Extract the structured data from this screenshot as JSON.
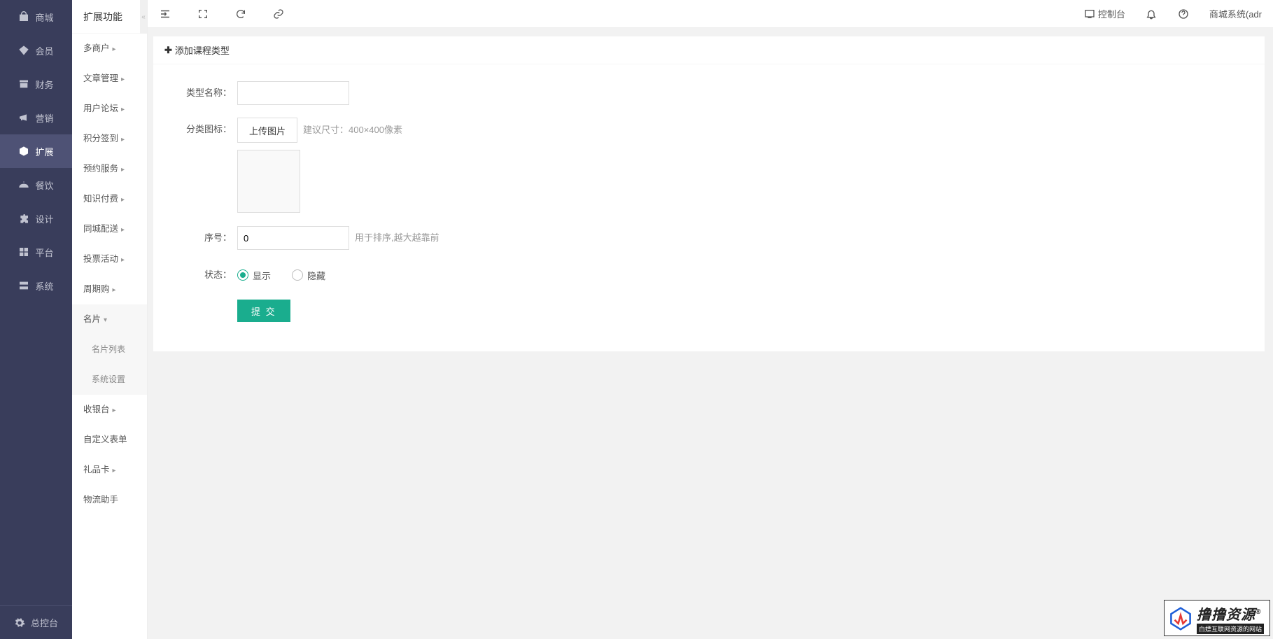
{
  "sidebar_primary": {
    "items": [
      {
        "label": "商城",
        "icon": "bag-icon"
      },
      {
        "label": "会员",
        "icon": "diamond-icon"
      },
      {
        "label": "财务",
        "icon": "archive-icon"
      },
      {
        "label": "营销",
        "icon": "megaphone-icon"
      },
      {
        "label": "扩展",
        "icon": "cube-icon",
        "active": true
      },
      {
        "label": "餐饮",
        "icon": "dish-icon"
      },
      {
        "label": "设计",
        "icon": "puzzle-icon"
      },
      {
        "label": "平台",
        "icon": "grid-icon"
      },
      {
        "label": "系统",
        "icon": "server-icon"
      }
    ],
    "bottom": {
      "label": "总控台",
      "icon": "gear-icon"
    }
  },
  "sidebar_secondary": {
    "title": "扩展功能",
    "items": [
      {
        "label": "多商户",
        "caret": true
      },
      {
        "label": "文章管理",
        "caret": true
      },
      {
        "label": "用户论坛",
        "caret": true
      },
      {
        "label": "积分签到",
        "caret": true
      },
      {
        "label": "预约服务",
        "caret": true
      },
      {
        "label": "知识付费",
        "caret": true
      },
      {
        "label": "同城配送",
        "caret": true
      },
      {
        "label": "投票活动",
        "caret": true
      },
      {
        "label": "周期购",
        "caret": true
      },
      {
        "label": "名片",
        "caret_down": true,
        "open": true,
        "children": [
          {
            "label": "名片列表"
          },
          {
            "label": "系统设置"
          }
        ]
      },
      {
        "label": "收银台",
        "caret": true
      },
      {
        "label": "自定义表单"
      },
      {
        "label": "礼品卡",
        "caret": true
      },
      {
        "label": "物流助手"
      }
    ]
  },
  "topbar": {
    "console_label": "控制台",
    "user_label": "商城系统(adr"
  },
  "panel": {
    "header_label": "添加课程类型"
  },
  "form": {
    "name_label": "类型名称：",
    "name_value": "",
    "icon_label": "分类图标：",
    "upload_label": "上传图片",
    "size_hint": "建议尺寸：400×400像素",
    "sort_label": "序号：",
    "sort_value": "0",
    "sort_hint": "用于排序,越大越靠前",
    "status_label": "状态：",
    "status_show": "显示",
    "status_hide": "隐藏",
    "submit_label": "提 交"
  },
  "watermark": {
    "main": "撸撸资源",
    "reg": "®",
    "sub": "白嫖互联网资源的网站"
  }
}
